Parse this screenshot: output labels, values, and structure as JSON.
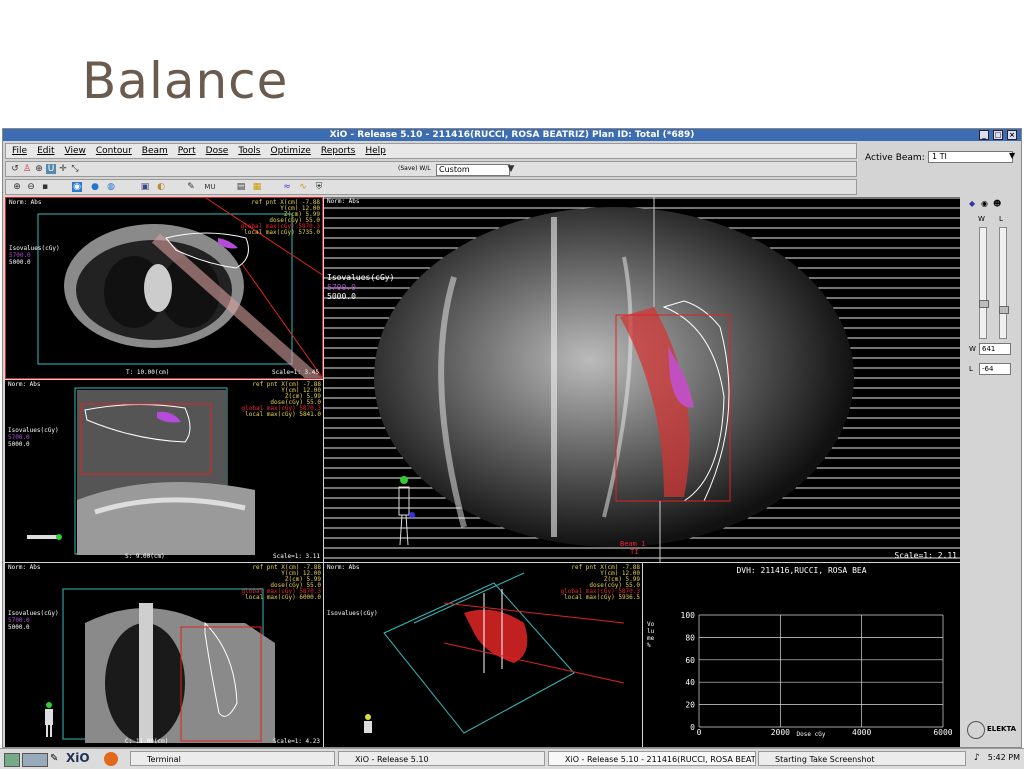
{
  "slide": {
    "title": "Balance"
  },
  "window": {
    "title": "XiO - Release 5.10 - 211416(RUCCI, ROSA BEATRIZ) Plan ID: Total (*689)"
  },
  "menu": [
    "File",
    "Edit",
    "View",
    "Contour",
    "Beam",
    "Port",
    "Dose",
    "Tools",
    "Optimize",
    "Reports",
    "Help"
  ],
  "toolbar": {
    "save_wl": "(Save) W/L",
    "preset": "Custom"
  },
  "active_beam": {
    "label": "Active Beam:",
    "value": "1 TI"
  },
  "overlay": {
    "norm": "Norm: Abs",
    "isovalues": "Isovalues(cGy)",
    "iso1": "5700.0",
    "iso2": "5000.0",
    "refpnt_lines": [
      "ref pnt X(cm)  -7.88",
      "Y(cm)  12.00",
      "Z(cm)   5.99",
      "dose(cGy)  55.0"
    ],
    "global_max": "global max(cGy) 5870.3",
    "local_max1": "local max(cGy) 5735.0",
    "local_max2": "local max(cGy) 5841.0",
    "local_max3": "local max(cGy) 6000.0",
    "local_max4": "local max(cGy) 5936.5"
  },
  "panes": {
    "axial": {
      "slice": "T:  10.00(cm)",
      "scale": "Scale=1: 3.45"
    },
    "sagittal": {
      "slice": "S:   9.00(cm)",
      "scale": "Scale=1: 3.11"
    },
    "coronal": {
      "slice": "C:  11.00(cm)",
      "scale": "Scale=1: 4.23"
    },
    "bev": {
      "scale": "Scale=1: 2.11",
      "beam": "Beam 1",
      "beam_sub": "TI"
    },
    "dvh": {
      "title": "DVH: 211416,RUCCI, ROSA BEA",
      "ylabel": "Volume %",
      "xlabel": "Dose cGy"
    }
  },
  "chart_data": {
    "type": "line",
    "title": "DVH: 211416,RUCCI, ROSA BEA",
    "xlabel": "Dose cGy",
    "ylabel": "Volume %",
    "xlim": [
      0,
      6000
    ],
    "ylim": [
      0,
      100
    ],
    "xticks": [
      0,
      2000,
      4000,
      6000
    ],
    "yticks": [
      0,
      20,
      40,
      60,
      80,
      100
    ],
    "grid": true,
    "series": []
  },
  "sidebar": {
    "w_label": "W",
    "l_label": "L",
    "w_value": "641",
    "l_value": "-64",
    "logo": "ELEKTA"
  },
  "taskbar": {
    "items": [
      "Terminal",
      "XiO - Release 5.10",
      "XiO - Release 5.10 - 211416(RUCCI, ROSA BEATRIZ) ...",
      "Starting Take Screenshot"
    ],
    "clock": "5:42 PM",
    "brand": "XiO"
  },
  "colors": {
    "iso_high": "#b44bd9",
    "iso_low": "#ffffff",
    "overlay_text": "#e8d44d",
    "ptv": "#e03030",
    "titlebar": "#3c6db3"
  }
}
